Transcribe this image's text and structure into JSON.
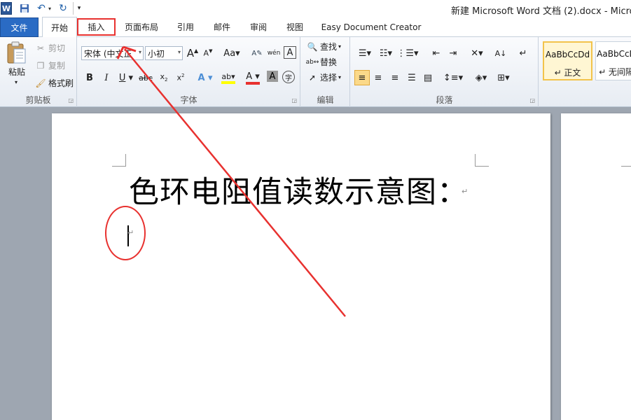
{
  "window": {
    "logo": "W",
    "title": "新建 Microsoft Word 文档 (2).docx - Micros"
  },
  "tabs": {
    "file": "文件",
    "home": "开始",
    "insert": "插入",
    "layout": "页面布局",
    "references": "引用",
    "mailings": "邮件",
    "review": "审阅",
    "view": "视图",
    "easy": "Easy Document Creator"
  },
  "ribbon": {
    "clipboard": {
      "label": "剪贴板",
      "paste": "粘贴",
      "cut": "剪切",
      "copy": "复制",
      "painter": "格式刷"
    },
    "font": {
      "label": "字体",
      "name": "宋体 (中文正",
      "size": "小初"
    },
    "editing": {
      "label": "编辑",
      "find": "查找",
      "replace": "替换",
      "select": "选择"
    },
    "paragraph": {
      "label": "段落"
    },
    "styles": {
      "normal_sample": "AaBbCcDd",
      "normal_name": "↵ 正文",
      "nospace_sample": "AaBbCcD",
      "nospace_name": "↵ 无间隔"
    }
  },
  "document": {
    "heading": "色环电阻值读数示意图：",
    "para_mark": "↵"
  },
  "colors": {
    "file_tab": "#2a6bc4",
    "annotation": "#e8312f",
    "highlight_style": "#f2c34b"
  }
}
